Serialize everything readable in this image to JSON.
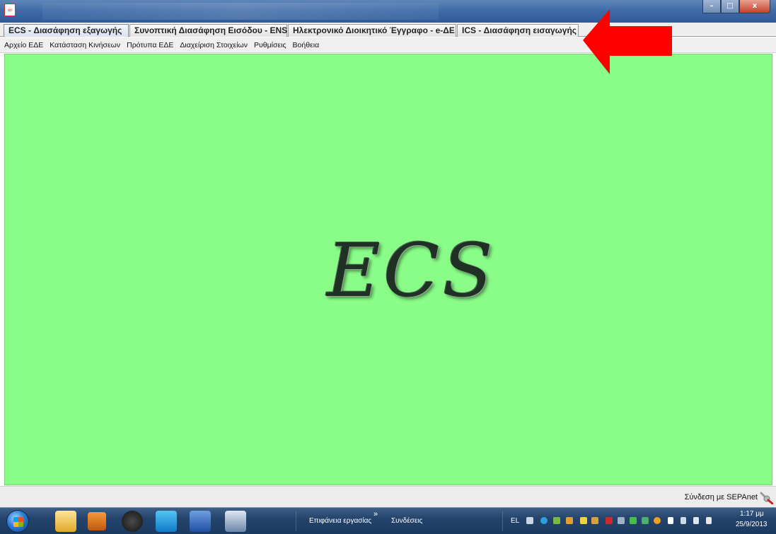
{
  "tabs": [
    {
      "label": "ECS - Διασάφηση εξαγωγής",
      "active": true
    },
    {
      "label": "Συνοπτική Διασάφηση Εισόδου - ENS",
      "active": false
    },
    {
      "label": "Ηλεκτρονικό Διοικητικό Έγγραφο - e-ΔΕ",
      "active": false
    },
    {
      "label": "ICS - Διασάφηση εισαγωγής",
      "active": false
    }
  ],
  "menu": [
    "Αρχείο ΕΔΕ",
    "Κατάσταση Κινήσεων",
    "Πρότυπα ΕΔΕ",
    "Διαχείριση Στοιχείων",
    "Ρυθμίσεις",
    "Βοήθεια"
  ],
  "main": {
    "logo_text": "ECS",
    "background_color": "#89fd88"
  },
  "status": {
    "connection_label": "Σύνδεση με SEPAnet"
  },
  "window_buttons": {
    "minimize": "–",
    "maximize": "□",
    "close": "x"
  },
  "taskbar": {
    "toolbar_label": "Επιφάνεια εργασίας",
    "chevron": "»",
    "connections_label": "Συνδέσεις",
    "language": "EL",
    "clock_time": "1:17 μμ",
    "clock_date": "25/9/2013"
  },
  "icons": {
    "app": "java-icon",
    "arrow": "red-arrow",
    "plug": "plug-icon",
    "start": "windows-start-icon"
  },
  "colors": {
    "main_bg": "#89fd88",
    "arrow": "#ff0000",
    "taskbar": "#1c3a60"
  }
}
